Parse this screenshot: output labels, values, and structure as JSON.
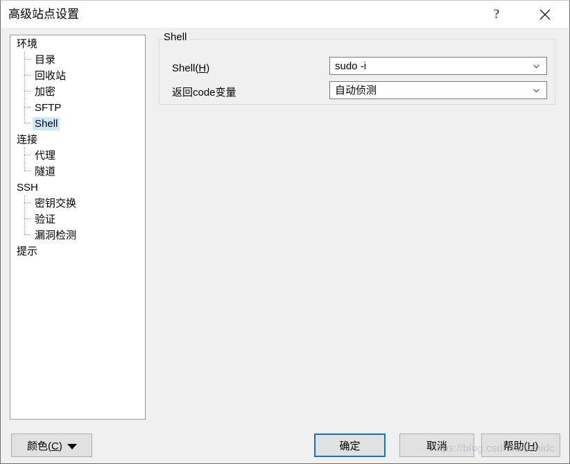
{
  "window": {
    "title": "高级站点设置",
    "help_icon": "question-mark-icon",
    "close_icon": "close-icon"
  },
  "tree": {
    "selected": "Shell",
    "items": [
      {
        "label": "环境",
        "level": 0,
        "last": false
      },
      {
        "label": "目录",
        "level": 1,
        "last": false
      },
      {
        "label": "回收站",
        "level": 1,
        "last": false
      },
      {
        "label": "加密",
        "level": 1,
        "last": false
      },
      {
        "label": "SFTP",
        "level": 1,
        "last": false
      },
      {
        "label": "Shell",
        "level": 1,
        "last": true
      },
      {
        "label": "连接",
        "level": 0,
        "last": false
      },
      {
        "label": "代理",
        "level": 1,
        "last": false
      },
      {
        "label": "隧道",
        "level": 1,
        "last": true
      },
      {
        "label": "SSH",
        "level": 0,
        "last": false
      },
      {
        "label": "密钥交换",
        "level": 1,
        "last": false
      },
      {
        "label": "验证",
        "level": 1,
        "last": false
      },
      {
        "label": "漏洞检测",
        "level": 1,
        "last": true
      },
      {
        "label": "提示",
        "level": 0,
        "last": false
      }
    ]
  },
  "shell_panel": {
    "group_caption": "Shell",
    "shell_label_prefix": "Shell(",
    "shell_label_mnemonic": "H",
    "shell_label_suffix": ")",
    "shell_value": "sudo -i",
    "retcode_label": "返回code变量",
    "retcode_value": "自动侦测",
    "chevron_icon": "chevron-down-icon"
  },
  "footer": {
    "color_label": "颜色(",
    "color_mnemonic": "C",
    "color_suffix": ")",
    "color_arrow_icon": "triangle-down-icon",
    "ok_label": "确定",
    "cancel_label": "取消",
    "help_label_prefix": "帮助(",
    "help_mnemonic": "H",
    "help_label_suffix": ")",
    "accent_color": "#0078d7"
  },
  "watermark": {
    "text": "https://blog.csdn.net/zhidc"
  }
}
